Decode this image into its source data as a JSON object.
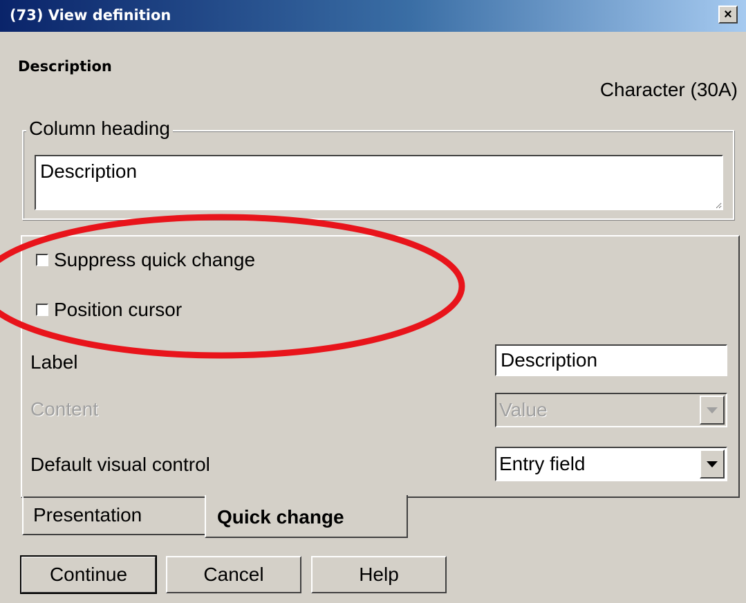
{
  "window": {
    "title": "(73) View definition",
    "close_glyph": "×"
  },
  "header": {
    "field_name": "Description",
    "field_type": "Character (30A)"
  },
  "column_heading": {
    "legend": "Column heading",
    "value": "Description"
  },
  "quick_change": {
    "suppress_label": "Suppress quick change",
    "suppress_checked": false,
    "position_cursor_label": "Position cursor",
    "position_cursor_checked": false,
    "label_caption": "Label",
    "label_value": "Description",
    "content_caption": "Content",
    "content_value": "Value",
    "visual_control_caption": "Default visual control",
    "visual_control_value": "Entry field"
  },
  "tabs": [
    {
      "label": "Presentation",
      "active": false
    },
    {
      "label": "Quick change",
      "active": true
    }
  ],
  "buttons": {
    "continue": "Continue",
    "cancel": "Cancel",
    "help": "Help"
  },
  "colors": {
    "annotation": "#e8141b",
    "window_bg": "#d4d0c8"
  }
}
